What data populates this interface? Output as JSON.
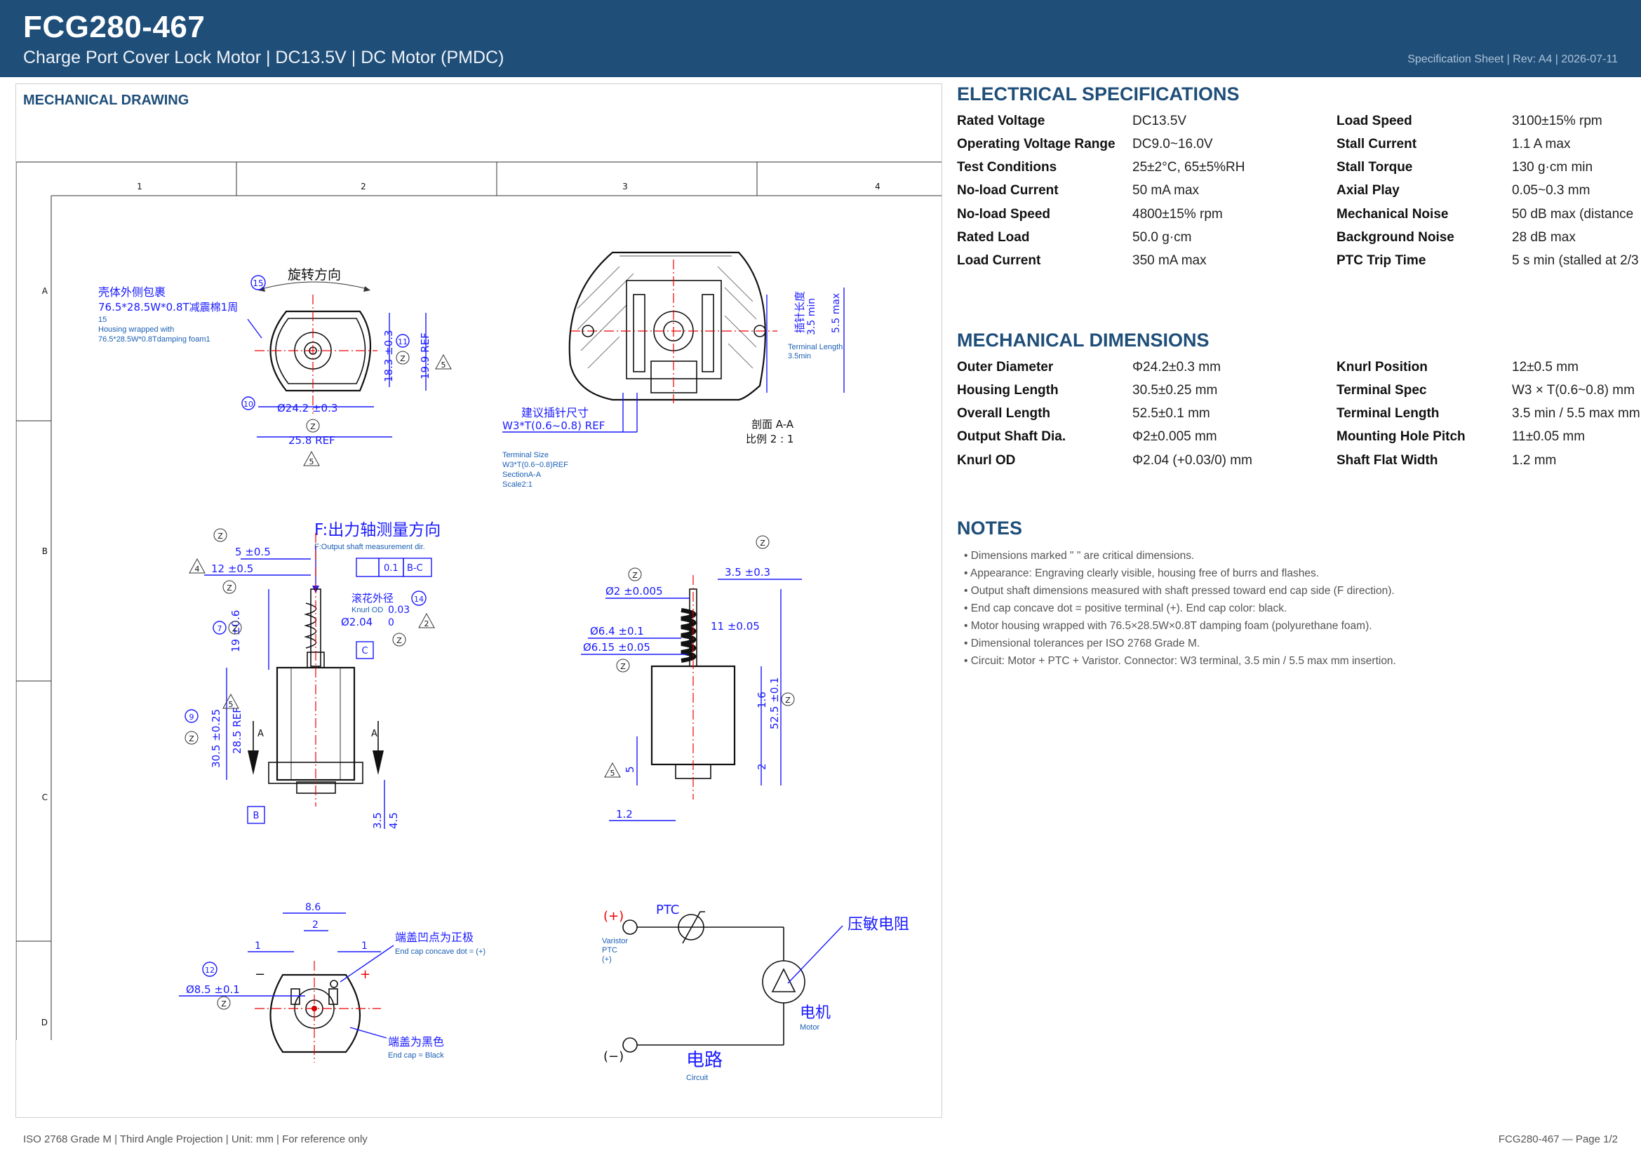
{
  "header": {
    "title": "FCG280-467",
    "subtitle": "Charge Port Cover Lock Motor  |  DC13.5V  |  DC Motor (PMDC)",
    "meta": "Specification Sheet  |  Rev: A4  |  2026-07-11"
  },
  "drawing": {
    "title": "MECHANICAL DRAWING",
    "grid_cols": [
      "1",
      "2",
      "3",
      "4"
    ],
    "grid_rows": [
      "A",
      "B",
      "C",
      "D"
    ],
    "view_a": {
      "rotation_cn": "旋转方向",
      "wrap_cn": "壳体外侧包裹",
      "wrap_cn2": "76.5*28.5W*0.8T减震棉1周",
      "wrap_num": "15",
      "wrap_en1": "Housing wrapped with",
      "wrap_en2": "76.5*28.5W*0.8Tdamping foam1",
      "dim_od": "Ø24.2 ±0.3",
      "dim_ref": "25.8 REF",
      "dim_h1": "18.3 ±0.3",
      "dim_h2": "19.9 REF",
      "balloon_15": "15",
      "balloon_11": "11",
      "balloon_10": "10",
      "balloon_5": "5",
      "balloon_z": "Z"
    },
    "section": {
      "pin_cn": "建议插针尺寸",
      "pin_spec": "W3*T(0.6~0.8) REF",
      "len_cn": "插针长度",
      "len_min": "3.5 min",
      "len_max": "5.5 max",
      "term_en1": "Terminal Length",
      "term_en2": "3.5min",
      "section_cn": "剖面 A-A",
      "scale_cn": "比例 2 : 1",
      "size_en1": "Terminal Size",
      "size_en2": "W3*T(0.6~0.8)REF",
      "size_en3": "SectionA-A",
      "size_en4": "Scale2:1"
    },
    "view_side": {
      "force_cn": "F:出力轴测量方向",
      "force_en": "F:Output shaft measurement dir.",
      "d5": "5 ±0.5",
      "d12": "12 ±0.5",
      "d19": "19 ±0.6",
      "d305": "30.5 ±0.25",
      "d285": "28.5 REF",
      "d35": "3.5",
      "d45": "4.5",
      "knurl_cn": "滚花外径",
      "knurl_en": "Knurl OD",
      "knurl_tol": "0.03",
      "knurl_dim": "Ø2.04",
      "knurl_low": "0",
      "frame_flat": "0.1",
      "frame_ref": "B-C",
      "datum_c": "C",
      "datum_b": "B",
      "sec_a": "A",
      "b4": "4",
      "b7": "7",
      "b9": "9",
      "b14": "14",
      "b2": "2",
      "b5": "5"
    },
    "view_shaft": {
      "d35": "3.5 ±0.3",
      "d2": "Ø2 ±0.005",
      "d64": "Ø6.4 ±0.1",
      "d615": "Ø6.15 ±0.05",
      "d11": "11 ±0.05",
      "d16": "1.6",
      "d525": "52.5 ±0.1",
      "d2b": "2",
      "d5": "5",
      "d12": "1.2",
      "b5": "5"
    },
    "view_end": {
      "d86": "8.6",
      "d2": "2",
      "d1a": "1",
      "d1b": "1",
      "d85": "Ø8.5 ±0.1",
      "b12": "12",
      "concave_cn": "端盖凹点为正极",
      "concave_en": "End cap concave dot = (+)",
      "black_cn": "端盖为黑色",
      "black_en": "End cap = Black",
      "plus": "+",
      "minus": "−"
    },
    "circuit": {
      "plus": "(+)",
      "minus": "(−)",
      "ptc": "PTC",
      "varistor_cn": "压敏电阻",
      "motor_cn": "电机",
      "motor_en": "Motor",
      "circuit_cn": "电路",
      "circuit_en": "Circuit",
      "legend1": "Varistor",
      "legend2": "PTC",
      "legend3": "(+)"
    }
  },
  "electrical": {
    "title": "ELECTRICAL SPECIFICATIONS",
    "left": [
      {
        "label": "Rated Voltage",
        "value": "DC13.5V"
      },
      {
        "label": "Operating Voltage Range",
        "value": "DC9.0~16.0V"
      },
      {
        "label": "Test Conditions",
        "value": "25±2°C, 65±5%RH"
      },
      {
        "label": "No-load Current",
        "value": "50 mA max"
      },
      {
        "label": "No-load Speed",
        "value": "4800±15% rpm"
      },
      {
        "label": "Rated Load",
        "value": "50.0 g·cm"
      },
      {
        "label": "Load Current",
        "value": "350 mA max"
      }
    ],
    "right": [
      {
        "label": "Load Speed",
        "value": "3100±15% rpm"
      },
      {
        "label": "Stall Current",
        "value": "1.1 A max"
      },
      {
        "label": "Stall Torque",
        "value": "130 g·cm min"
      },
      {
        "label": "Axial Play",
        "value": "0.05~0.3 mm"
      },
      {
        "label": "Mechanical Noise",
        "value": "50 dB max (distance"
      },
      {
        "label": "Background Noise",
        "value": "28 dB max"
      },
      {
        "label": "PTC Trip Time",
        "value": "5 s min (stalled at 2/3"
      }
    ]
  },
  "mechanical": {
    "title": "MECHANICAL DIMENSIONS",
    "left": [
      {
        "label": "Outer Diameter",
        "value": "Φ24.2±0.3 mm"
      },
      {
        "label": "Housing Length",
        "value": "30.5±0.25 mm"
      },
      {
        "label": "Overall Length",
        "value": "52.5±0.1 mm"
      },
      {
        "label": "Output Shaft Dia.",
        "value": "Φ2±0.005 mm"
      },
      {
        "label": "Knurl OD",
        "value": "Φ2.04 (+0.03/0) mm"
      }
    ],
    "right": [
      {
        "label": "Knurl Position",
        "value": "12±0.5 mm"
      },
      {
        "label": "Terminal Spec",
        "value": "W3 × T(0.6~0.8) mm"
      },
      {
        "label": "Terminal Length",
        "value": "3.5 min / 5.5 max mm"
      },
      {
        "label": "Mounting Hole Pitch",
        "value": "11±0.05 mm"
      },
      {
        "label": "Shaft Flat Width",
        "value": "1.2 mm"
      }
    ]
  },
  "notes": {
    "title": "NOTES",
    "items": [
      "• Dimensions marked \"  \" are critical dimensions.",
      "• Appearance: Engraving clearly visible, housing free of burrs and flashes.",
      "• Output shaft dimensions measured with shaft pressed toward end cap side (F direction).",
      "• End cap concave dot = positive terminal (+). End cap color: black.",
      "• Motor housing wrapped with 76.5×28.5W×0.8T damping foam (polyurethane foam).",
      "• Dimensional tolerances per ISO 2768 Grade M.",
      "• Circuit: Motor + PTC + Varistor. Connector: W3 terminal, 3.5 min / 5.5 max mm insertion."
    ]
  },
  "footer": {
    "left": "ISO 2768 Grade M  |  Third Angle Projection  |  Unit: mm  |  For reference only",
    "right": "FCG280-467  —  Page 1/2"
  },
  "colors": {
    "brand": "#1f4e79",
    "dimension": "#1a1aff",
    "centerline": "#e00000"
  }
}
